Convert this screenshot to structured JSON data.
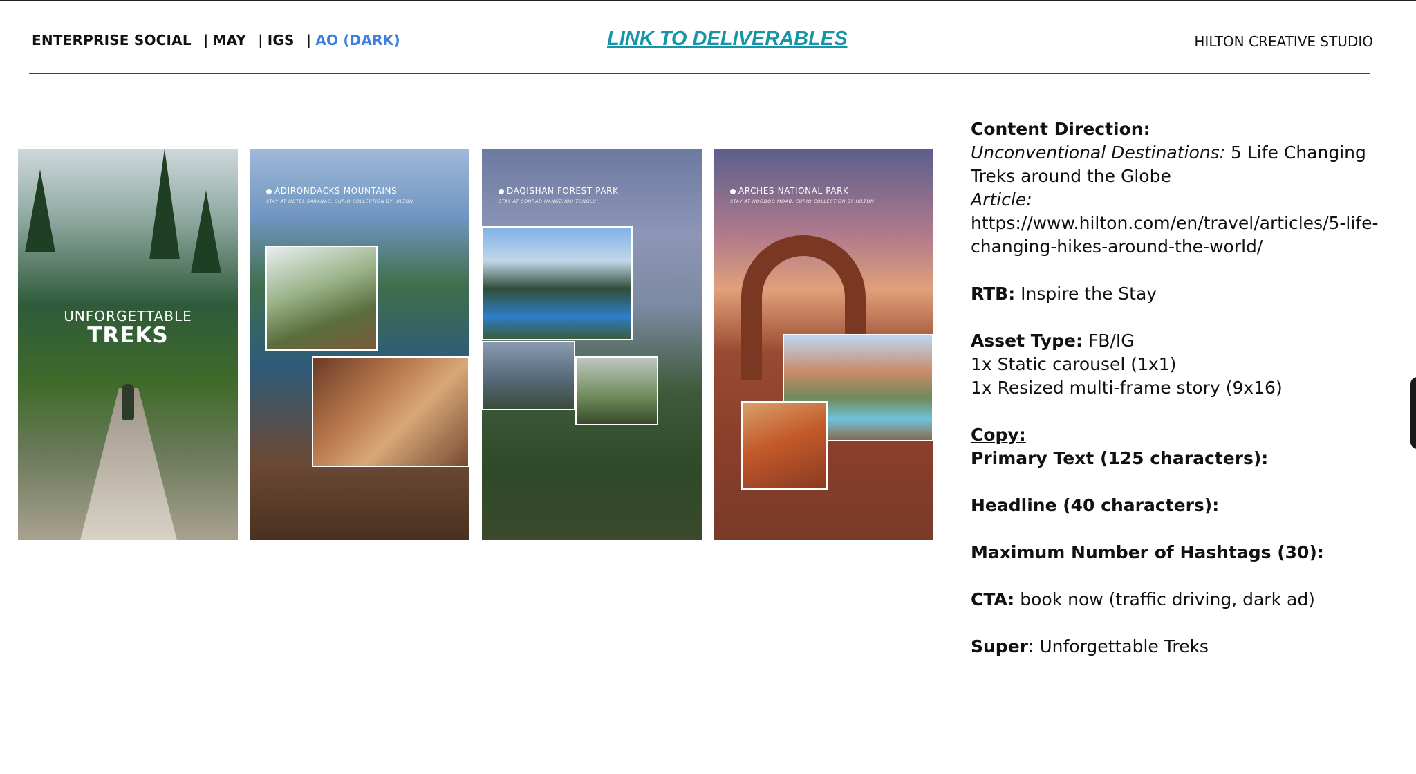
{
  "header": {
    "segment1": "ENTERPRISE SOCIAL",
    "segment2": "MAY",
    "segment3": "IGS",
    "segment4": "AO (DARK)",
    "separator": "|",
    "deliverables_link": "LINK TO DELIVERABLES",
    "studio": "HILTON CREATIVE STUDIO",
    "accent_color": "#3d7fe0",
    "link_color": "#1795a8"
  },
  "frames": [
    {
      "overlay_line1": "UNFORGETTABLE",
      "overlay_line2": "TREKS"
    },
    {
      "location": "ADIRONDACKS MOUNTAINS",
      "stay": "STAY AT HOTEL SARANAC, CURIO COLLECTION BY HILTON"
    },
    {
      "location": "DAQISHAN FOREST PARK",
      "stay": "STAY AT CONRAD HANGZHOU TONGLU"
    },
    {
      "location": "ARCHES NATIONAL PARK",
      "stay": "STAY AT HOODOO MOAB, CURIO COLLECTION BY HILTON"
    }
  ],
  "copy": {
    "content_direction_label": "Content Direction:",
    "destinations_label": "Unconventional Destinations:",
    "destinations_value": " 5 Life Changing Treks around the Globe",
    "article_label": "Article:",
    "article_url": "https://www.hilton.com/en/travel/articles/5-life-changing-hikes-around-the-world/",
    "rtb_label": "RTB:",
    "rtb_value": " Inspire the Stay",
    "asset_type_label": "Asset Type:",
    "asset_type_value": " FB/IG",
    "asset_line2": "1x Static carousel (1x1)",
    "asset_line3": "1x Resized multi-frame story (9x16)",
    "copy_label": "Copy:",
    "primary_text_label": "Primary Text (125 characters):",
    "headline_label": "Headline (40 characters):",
    "hashtags_label": "Maximum Number of Hashtags (30):",
    "cta_label": "CTA:",
    "cta_value": " book now (traffic driving, dark ad)",
    "super_label": "Super",
    "super_value": ": Unforgettable Treks"
  }
}
